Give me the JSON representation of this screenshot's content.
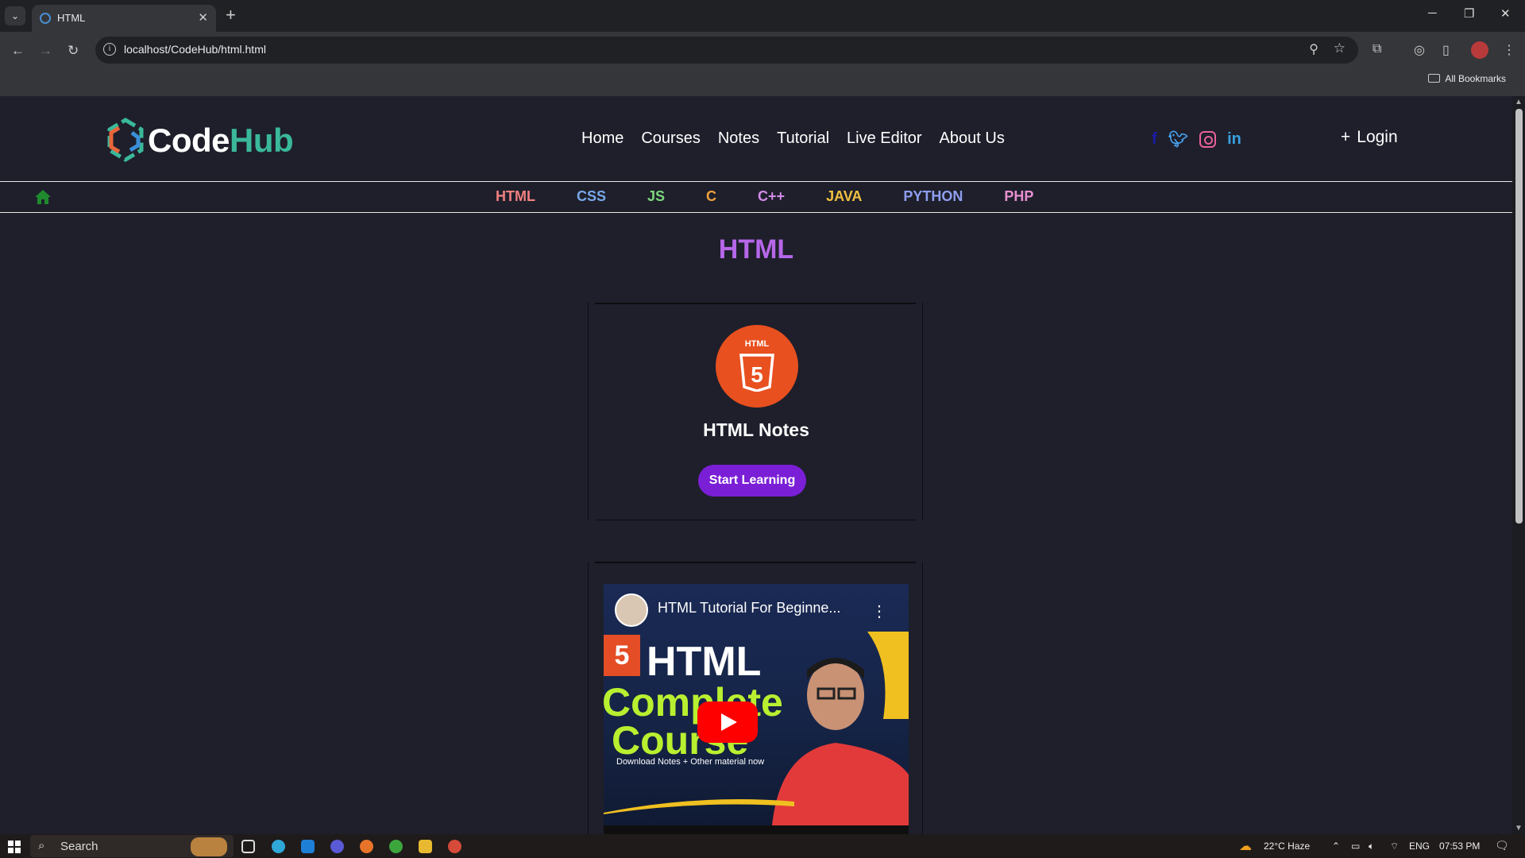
{
  "browser": {
    "tab_title": "HTML",
    "url": "localhost/CodeHub/html.html",
    "bookmarks_label": "All Bookmarks"
  },
  "site": {
    "logo_code": "Code",
    "logo_hub": "Hub",
    "nav": [
      "Home",
      "Courses",
      "Notes",
      "Tutorial",
      "Live Editor",
      "About Us"
    ],
    "login_label": "Login",
    "languages": [
      {
        "label": "HTML",
        "color": "#f08080"
      },
      {
        "label": "CSS",
        "color": "#7aa8e8"
      },
      {
        "label": "JS",
        "color": "#7cd67c"
      },
      {
        "label": "C",
        "color": "#f0a040"
      },
      {
        "label": "C++",
        "color": "#d48be8"
      },
      {
        "label": "JAVA",
        "color": "#f0c040"
      },
      {
        "label": "PYTHON",
        "color": "#8f9ef0"
      },
      {
        "label": "PHP",
        "color": "#e88fd0"
      }
    ],
    "page_title": "HTML",
    "card": {
      "badge_text": "HTML",
      "title": "HTML Notes",
      "button": "Start Learning"
    },
    "video": {
      "title": "HTML Tutorial For Beginne...",
      "heading": "HTML",
      "line1": "Complete",
      "line2": "Course",
      "subtitle": "Download Notes + Other material now"
    }
  },
  "taskbar": {
    "search_label": "Search",
    "weather": "22°C  Haze",
    "lang": "ENG",
    "time": "07:53 PM"
  }
}
